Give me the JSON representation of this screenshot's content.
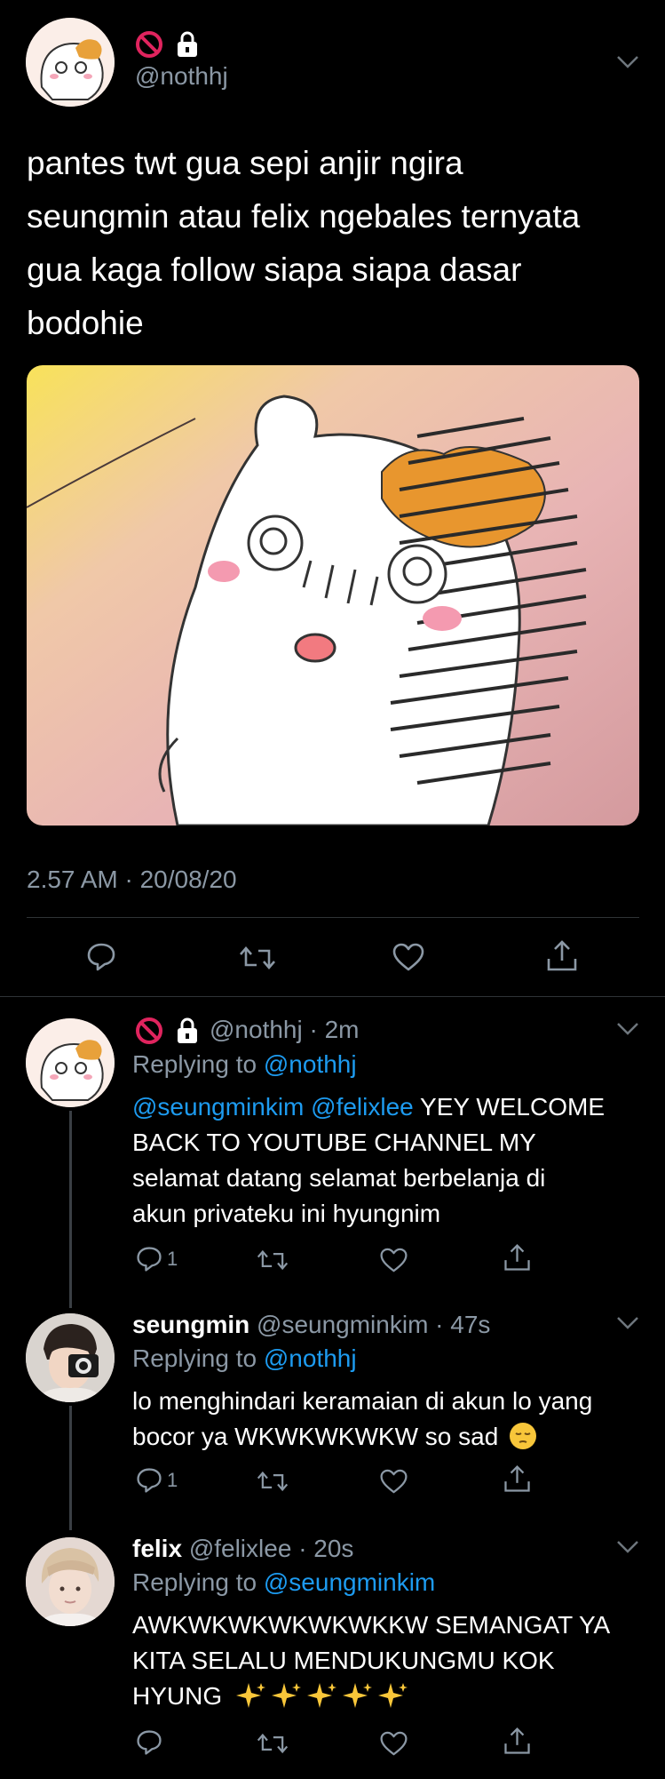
{
  "main_tweet": {
    "handle": "@nothhj",
    "text_lines": [
      "pantes twt gua sepi anjir ngira",
      "seungmin atau felix ngebales ternyata",
      "gua kaga follow siapa siapa dasar",
      "bodohie"
    ],
    "timestamp": "2.57 AM · 20/08/20"
  },
  "replies": [
    {
      "handle": "@nothhj",
      "time": "· 2m",
      "replying_prefix": "Replying to",
      "replying_to": "@nothhj",
      "line1_mentions": "@seungminkim @felixlee",
      "line1_rest": " YEY WELCOME",
      "lines": [
        "BACK TO YOUTUBE CHANNEL MY",
        "selamat datang selamat berbelanja di",
        "akun privateku ini hyungnim"
      ],
      "reply_count": "1"
    },
    {
      "name": "seungmin",
      "handle": "@seungminkim",
      "time": "· 47s",
      "replying_prefix": "Replying to",
      "replying_to": "@nothhj",
      "lines": [
        "lo menghindari keramaian di akun lo yang",
        "bocor ya WKWKWKWKW so sad"
      ],
      "reply_count": "1"
    },
    {
      "name": "felix",
      "handle": "@felixlee",
      "time": "· 20s",
      "replying_prefix": "Replying to",
      "replying_to": "@seungminkim",
      "lines": [
        "AWKWKWKWKWKWKKW SEMANGAT YA",
        "KITA SELALU MENDUKUNGMU KOK",
        "HYUNG"
      ]
    }
  ],
  "icons": {
    "no_entry": "no-entry-icon",
    "lock": "lock-icon",
    "reply": "reply-icon",
    "retweet": "retweet-icon",
    "like": "heart-icon",
    "share": "share-icon",
    "chevron": "chevron-down-icon",
    "sad_emoji": "pensive-face-icon",
    "sparkles": "sparkles-icon"
  },
  "colors": {
    "background": "#000000",
    "link": "#1d9bf0",
    "muted": "#8b98a5",
    "no_entry_red": "#e0245e"
  }
}
